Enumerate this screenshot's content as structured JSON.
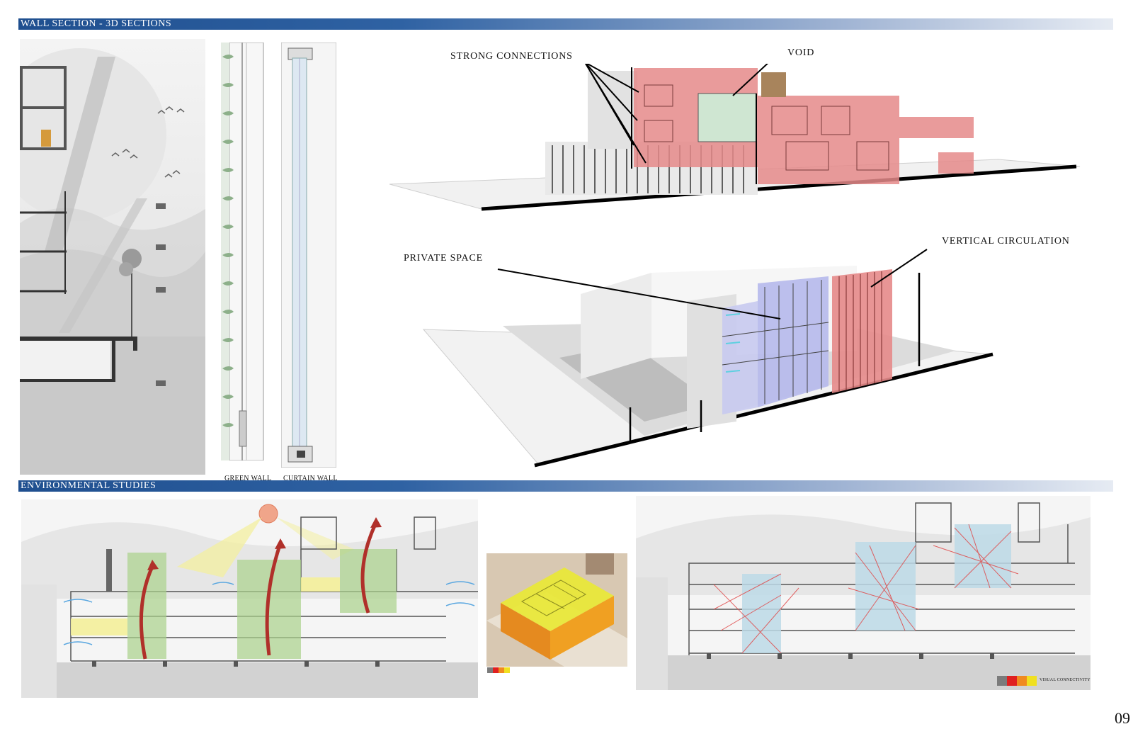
{
  "sections": {
    "wall_title": "WALL SECTION - 3D SECTIONS",
    "env_title": "ENVIRONMENTAL STUDIES"
  },
  "wall_labels": {
    "green_wall": "GREEN WALL",
    "curtain_wall": "CURTAIN WALL"
  },
  "callouts": {
    "strong_connections": "STRONG CONNECTIONS",
    "void": "VOID",
    "private_space": "PRIVATE SPACE",
    "vertical_circulation": "VERTICAL CIRCULATION"
  },
  "legends": {
    "visual_connectivity": "VISUAL CONNECTIVITY"
  },
  "colors": {
    "band_dark": "#1f4f8f",
    "connection_red": "#e58a8a",
    "private_blue": "#b6b9ec",
    "void_green": "#cfe6d2",
    "heat_yellow": "#e9e83a",
    "heat_orange": "#e58a1f"
  },
  "page_number": "09"
}
